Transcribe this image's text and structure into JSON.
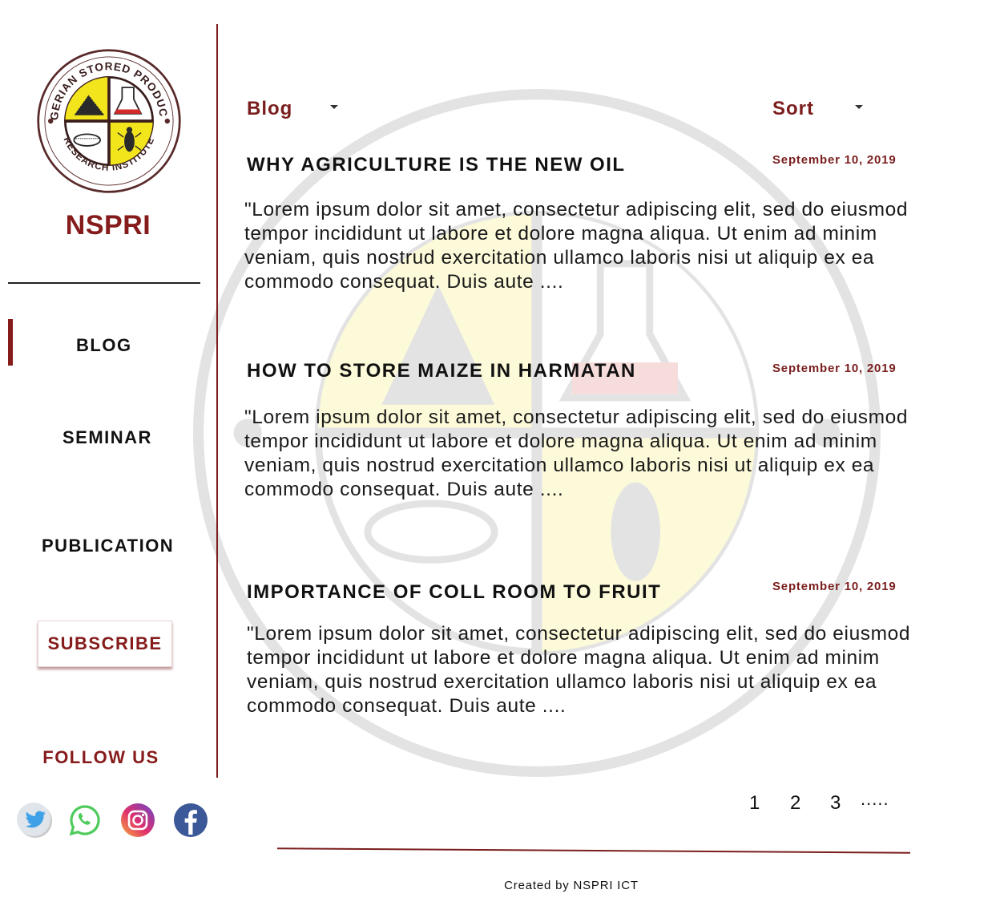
{
  "brand": {
    "name": "NSPRI",
    "logo_text_top": "NIGERIAN STORED PRODUCTS",
    "logo_text_bottom": "RESEARCH INSTITUTE"
  },
  "nav": {
    "items": [
      {
        "label": "BLOG",
        "active": true
      },
      {
        "label": "SEMINAR",
        "active": false
      },
      {
        "label": "PUBLICATION",
        "active": false
      }
    ],
    "subscribe_label": "SUBSCRIBE",
    "follow_label": "FOLLOW US",
    "social_icons": [
      "twitter-icon",
      "whatsapp-icon",
      "instagram-icon",
      "facebook-icon"
    ]
  },
  "filters": {
    "category_label": "Blog",
    "sort_label": "Sort"
  },
  "posts": [
    {
      "title": "WHY AGRICULTURE IS THE NEW OIL",
      "date": "September 10, 2019",
      "excerpt": "\"Lorem ipsum dolor sit amet, consectetur adipiscing elit, sed do eiusmod tempor incididunt ut labore et dolore magna aliqua. Ut enim ad minim veniam, quis nostrud exercitation ullamco laboris nisi ut aliquip ex ea commodo consequat. Duis aute ...."
    },
    {
      "title": "HOW TO STORE MAIZE IN HARMATAN",
      "date": "September 10, 2019",
      "excerpt": "\"Lorem ipsum dolor sit amet, consectetur adipiscing elit, sed do eiusmod tempor incididunt ut labore et dolore magna aliqua. Ut enim ad minim veniam, quis nostrud exercitation ullamco laboris nisi ut aliquip ex ea commodo consequat. Duis aute ...."
    },
    {
      "title": "IMPORTANCE OF COLL ROOM TO FRUIT",
      "date": "September 10, 2019",
      "excerpt": "\"Lorem ipsum dolor sit amet, consectetur adipiscing elit, sed do eiusmod tempor incididunt ut labore et dolore magna aliqua. Ut enim ad minim veniam, quis nostrud exercitation ullamco laboris nisi ut aliquip ex ea commodo consequat. Duis aute ...."
    }
  ],
  "pagination": {
    "pages": [
      "1",
      "2",
      "3"
    ],
    "more": "....."
  },
  "footer": {
    "text": "Created by NSPRI ICT"
  },
  "colors": {
    "accent": "#861b1b",
    "logo_yellow": "#f3e51c",
    "logo_red": "#d42a2a"
  }
}
